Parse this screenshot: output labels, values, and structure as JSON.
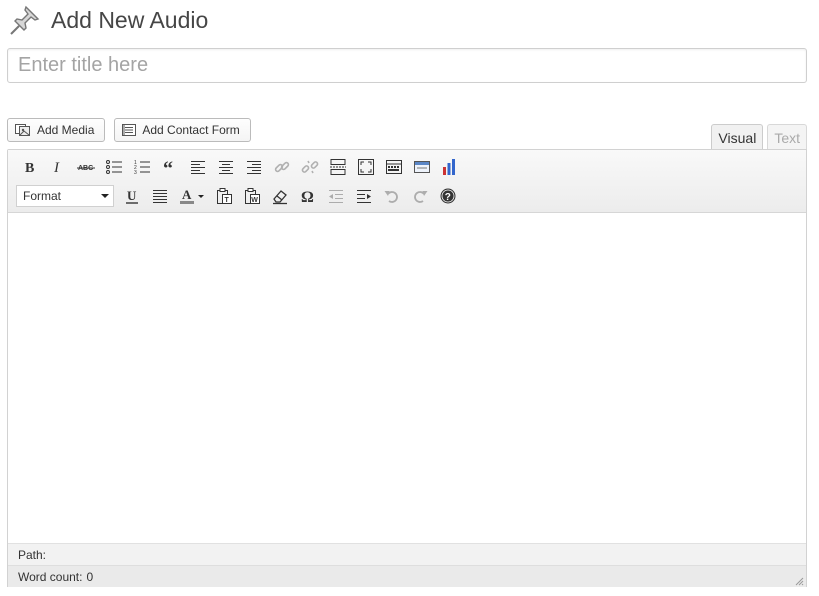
{
  "header": {
    "title": "Add New Audio",
    "icon": "pushpin-icon"
  },
  "title_field": {
    "placeholder": "Enter title here",
    "value": ""
  },
  "media_buttons": {
    "add_media": "Add Media",
    "add_contact_form": "Add Contact Form"
  },
  "tabs": {
    "visual": "Visual",
    "text": "Text",
    "active": "visual"
  },
  "toolbar": {
    "format_select": "Format",
    "row1": [
      "bold",
      "italic",
      "strikethrough",
      "bullet-list",
      "numbered-list",
      "blockquote",
      "align-left",
      "align-center",
      "align-right",
      "insert-link",
      "remove-link",
      "insert-more",
      "fullscreen",
      "toolbar-toggle",
      "form",
      "chart"
    ],
    "row2": [
      "format",
      "underline",
      "justify",
      "text-color",
      "paste-as-text",
      "paste-from-word",
      "clear-formatting",
      "special-character",
      "outdent",
      "indent",
      "undo",
      "redo",
      "help"
    ]
  },
  "status": {
    "path_label": "Path:",
    "word_count_label": "Word count:",
    "word_count": "0"
  },
  "colors": {
    "accent_red": "#cc3333",
    "chart_blue": "#3366cc",
    "text_color_bar": "#888888"
  }
}
